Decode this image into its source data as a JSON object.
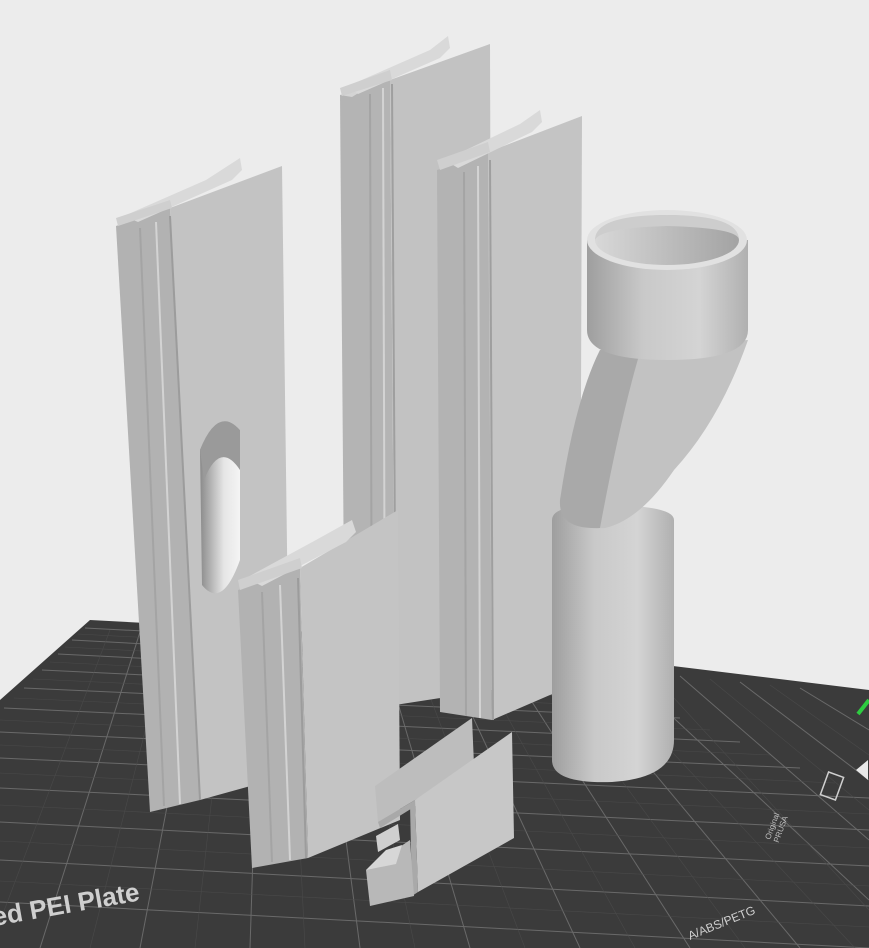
{
  "viewport": {
    "background": "#ececec",
    "bed_color": "#3a3a3a",
    "grid_color": "#7a7a7a",
    "part_color": "#bdbdbd",
    "part_light": "#d6d6d6",
    "part_dark": "#a6a6a6"
  },
  "bed": {
    "plate_text": "ed PEI Plate",
    "material_text": "A/ABS/PETG",
    "logo_text": "PRUSA",
    "logo_sub": "Original"
  },
  "axes": {
    "y_color": "#2ecc40"
  },
  "objects": [
    {
      "name": "rail-panel-with-slot"
    },
    {
      "name": "rail-panel-tall-center"
    },
    {
      "name": "rail-panel-tall-right"
    },
    {
      "name": "rail-panel-short"
    },
    {
      "name": "small-bracket-pieces"
    },
    {
      "name": "duct-adapter"
    }
  ]
}
